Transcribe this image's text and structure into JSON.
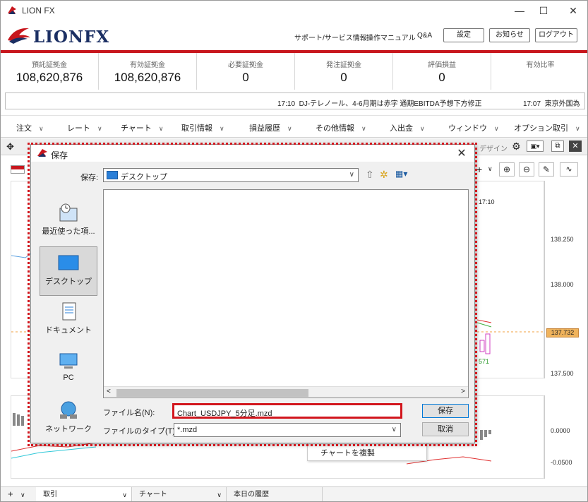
{
  "window": {
    "title": "LION FX",
    "minimize": "—",
    "maximize": "☐",
    "close": "✕"
  },
  "header": {
    "brand": "LIONFX",
    "links": [
      "サポート/サービス情報",
      "操作マニュアル",
      "Q&A"
    ],
    "buttons": [
      "設定",
      "お知らせ",
      "ログアウト"
    ]
  },
  "summary": [
    {
      "label": "預託証拠金",
      "value": "108,620,876"
    },
    {
      "label": "有効証拠金",
      "value": "108,620,876"
    },
    {
      "label": "必要証拠金",
      "value": "0"
    },
    {
      "label": "発注証拠金",
      "value": "0"
    },
    {
      "label": "評価損益",
      "value": "0"
    },
    {
      "label": "有効比率",
      "value": ""
    }
  ],
  "news": [
    {
      "time": "17:10",
      "text": "DJ-テレノール、4-6月期は赤字 通期EBITDA予想下方修正"
    },
    {
      "time": "17:07",
      "text": "東京外国為"
    }
  ],
  "menu": [
    "注文",
    "レート",
    "チャート",
    "取引情報",
    "損益履歴",
    "その他情報",
    "入出金",
    "ウィンドウ",
    "オプション取引"
  ],
  "chart": {
    "toolbar_label": "デザイン",
    "time_label": "17:10",
    "y_labels": [
      "138.250",
      "138.000",
      "137.500"
    ],
    "price_tag": "137.732",
    "candle_label": "571",
    "macd_labels": [
      "0.0000",
      "-0.0500"
    ],
    "context_menu_item": "チャートを複製"
  },
  "bottom_tabs": [
    "取引",
    "チャート",
    "本日の履歴"
  ],
  "dialog": {
    "title": "保存",
    "save_in_label": "保存:",
    "save_in_value": "デスクトップ",
    "places": [
      "最近使った項...",
      "デスクトップ",
      "ドキュメント",
      "PC",
      "ネットワーク"
    ],
    "filename_label": "ファイル名(N):",
    "filename_value": "Chart_USDJPY_5分足.mzd",
    "filetype_label": "ファイルのタイプ(T):",
    "filetype_value": "*.mzd",
    "save_button": "保存",
    "cancel_button": "取消"
  }
}
